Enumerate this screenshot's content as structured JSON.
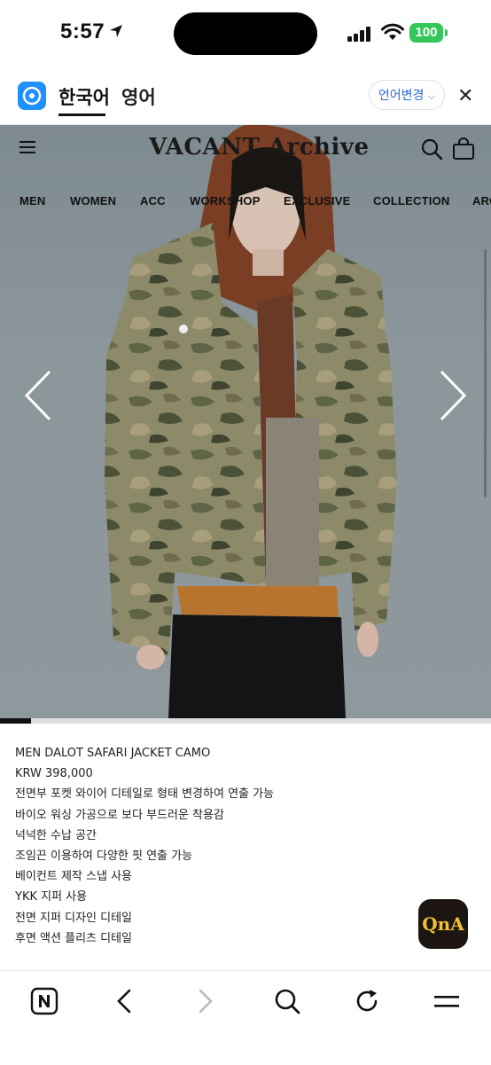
{
  "status": {
    "time": "5:57",
    "battery": "100"
  },
  "translate_bar": {
    "tab_korean": "한국어",
    "tab_english": "영어",
    "change_language": "언어변경"
  },
  "site": {
    "brand": "VACANT Archive",
    "nav": [
      "MEN",
      "WOMEN",
      "ACC",
      "WORKSHOP",
      "EXCLUSIVE",
      "COLLECTION",
      "ARC"
    ]
  },
  "slider": {
    "progress_fraction": 0.063
  },
  "product": {
    "name": "MEN DALOT SAFARI JACKET CAMO",
    "price": "KRW 398,000",
    "details": [
      "전면부 포켓 와이어 디테일로 형태 변경하여 연출 가능",
      "바이오 워싱 가공으로 보다 부드러운 착용감",
      "넉넉한 수납 공간",
      "조임끈 이용하여 다양한 핏 연출 가능",
      "베이컨트 제작 스냅 사용",
      "YKK 지퍼 사용",
      "전면 지퍼 디자인 디테일",
      "후면 액션 플리츠 디테일"
    ]
  },
  "qna_button": "QnA",
  "colors": {
    "accent_blue": "#2d6bd8",
    "battery_green": "#34c759",
    "qna_bg": "#1c1512",
    "qna_text": "#f2c230"
  },
  "icons": [
    "location-arrow-icon",
    "signal-icon",
    "wifi-icon",
    "papago-logo",
    "close-icon",
    "menu-icon",
    "search-icon",
    "shopping-bag-icon",
    "chevron-left-icon",
    "chevron-right-icon",
    "naver-icon",
    "back-icon",
    "forward-icon",
    "reload-icon"
  ]
}
